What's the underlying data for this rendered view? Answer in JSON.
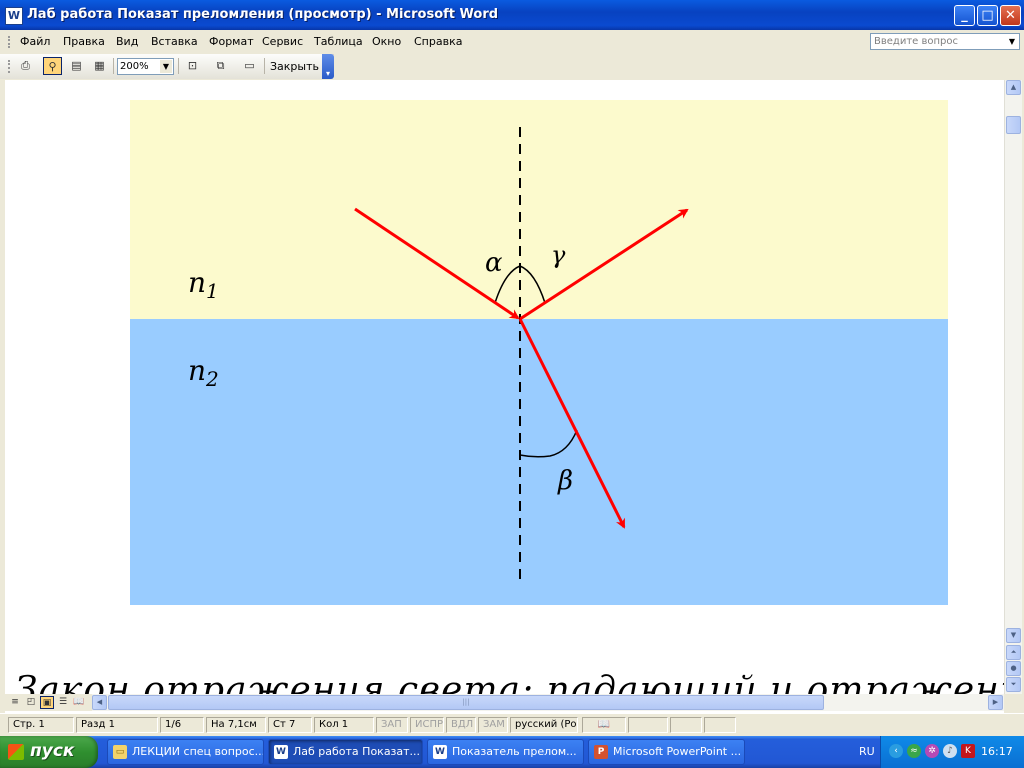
{
  "window": {
    "title": "Лаб работа Показат преломления (просмотр) - Microsoft Word",
    "app_icon": "word-doc-icon",
    "controls": {
      "minimize": "_",
      "maximize": "□",
      "close": "✕"
    }
  },
  "menu": {
    "items": [
      "Файл",
      "Правка",
      "Вид",
      "Вставка",
      "Формат",
      "Сервис",
      "Таблица",
      "Окно",
      "Справка"
    ],
    "ask_placeholder": "Введите вопрос"
  },
  "toolbar": {
    "zoom": "200%",
    "close_label": "Закрыть"
  },
  "figure": {
    "colors": {
      "medium1": "#fcfacd",
      "medium2": "#99ccff",
      "ray": "#ff0000"
    },
    "medium1_label": "n",
    "medium1_sub": "1",
    "medium2_label": "n",
    "medium2_sub": "2",
    "angle_incidence": "α",
    "angle_reflection": "γ",
    "angle_refraction": "β"
  },
  "document": {
    "text_line": "Закон отражения света: падающий и отраженный лучи"
  },
  "statusbar": {
    "page": "Стр. 1",
    "section": "Разд 1",
    "pages": "1/6",
    "position": "На 7,1см",
    "line": "Ст 7",
    "column": "Кол 1",
    "rec": "ЗАП",
    "trk": "ИСПР",
    "ext": "ВДЛ",
    "ovr": "ЗАМ",
    "language": "русский (Ро"
  },
  "taskbar": {
    "start": "пуск",
    "tasks": [
      {
        "label": "ЛЕКЦИИ спец вопрос...",
        "icon": "folder-icon"
      },
      {
        "label": "Лаб работа Показат...",
        "icon": "word-icon"
      },
      {
        "label": "Показатель прелом...",
        "icon": "word-icon"
      },
      {
        "label": "Microsoft PowerPoint ...",
        "icon": "powerpoint-icon"
      }
    ],
    "lang": "RU",
    "clock": "16:17"
  }
}
